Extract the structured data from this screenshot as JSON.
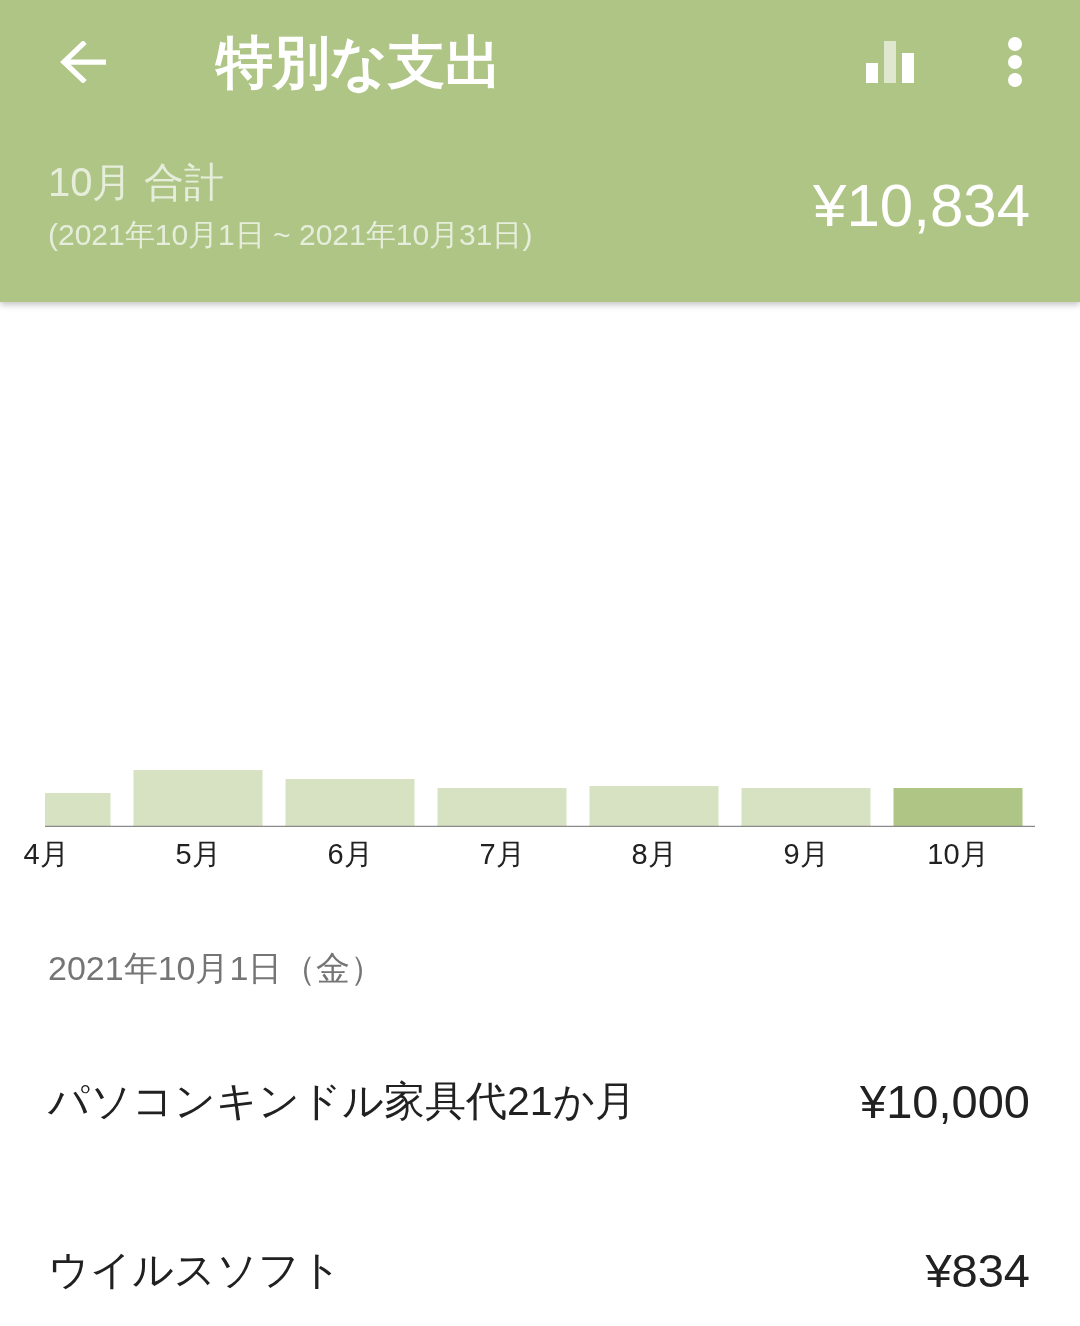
{
  "app_bar": {
    "title": "特別な支出"
  },
  "summary": {
    "label": "10月 合計",
    "period": "(2021年10月1日 ~ 2021年10月31日)",
    "total": "¥10,834"
  },
  "chart": {
    "months": [
      {
        "label": "4月",
        "selected": false
      },
      {
        "label": "5月",
        "selected": false
      },
      {
        "label": "6月",
        "selected": false
      },
      {
        "label": "7月",
        "selected": false
      },
      {
        "label": "8月",
        "selected": false
      },
      {
        "label": "9月",
        "selected": false
      },
      {
        "label": "10月",
        "selected": true
      }
    ]
  },
  "day_groups": [
    {
      "date": "2021年10月1日（金）",
      "items": [
        {
          "name": "パソコンキンドル家具代21か月",
          "amount": "¥10,000"
        },
        {
          "name": "ウイルスソフト",
          "amount": "¥834"
        }
      ]
    }
  ]
}
